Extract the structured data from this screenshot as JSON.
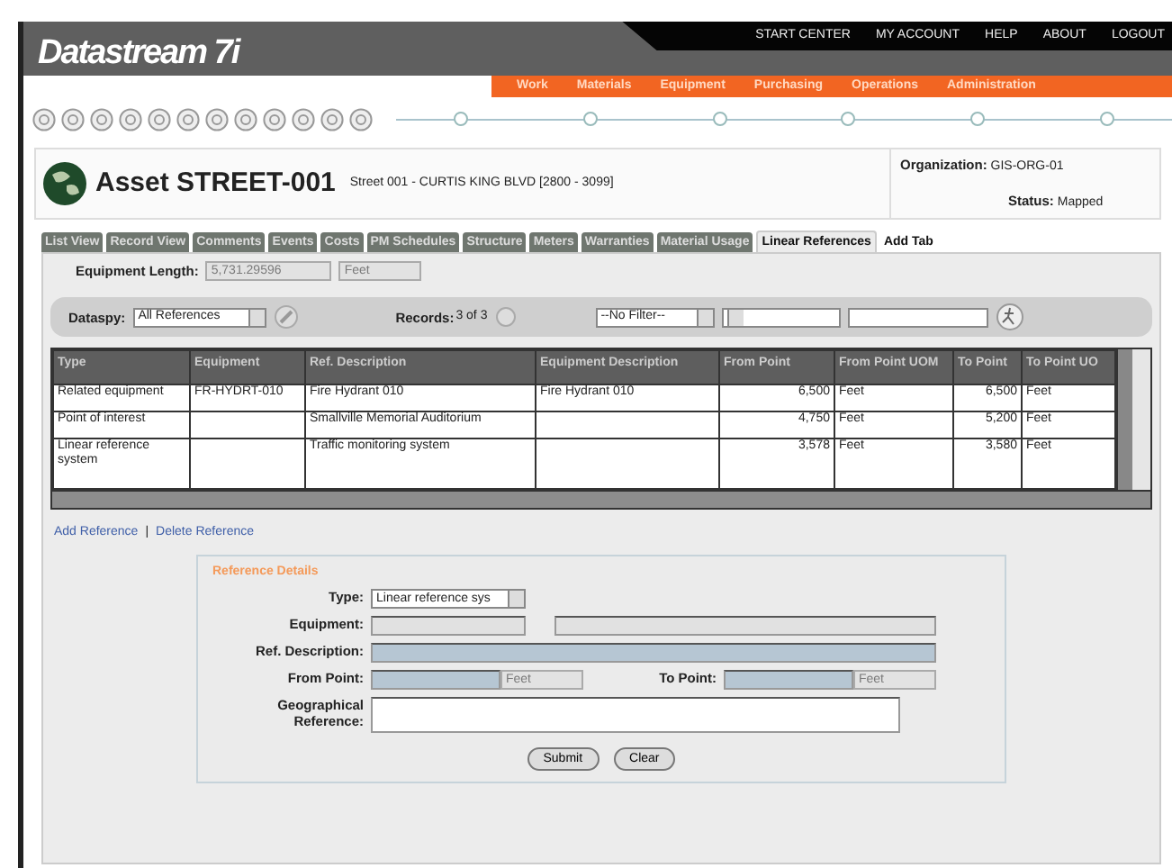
{
  "header": {
    "logo": "Datastream 7i",
    "top_links": [
      "START CENTER",
      "MY ACCOUNT",
      "HELP",
      "ABOUT",
      "LOGOUT"
    ],
    "modules": [
      "Work",
      "Materials",
      "Equipment",
      "Purchasing",
      "Operations",
      "Administration"
    ]
  },
  "asset": {
    "title": "Asset STREET-001",
    "subtitle": "Street 001 - CURTIS KING BLVD [2800 - 3099]",
    "organization_label": "Organization:",
    "organization": "GIS-ORG-01",
    "status_label": "Status:",
    "status": "Mapped"
  },
  "tabs": [
    {
      "label": "List View",
      "selected": false
    },
    {
      "label": "Record View",
      "selected": false
    },
    {
      "label": "Comments",
      "selected": false
    },
    {
      "label": "Events",
      "selected": false
    },
    {
      "label": "Costs",
      "selected": false
    },
    {
      "label": "PM Schedules",
      "selected": false
    },
    {
      "label": "Structure",
      "selected": false
    },
    {
      "label": "Meters",
      "selected": false
    },
    {
      "label": "Warranties",
      "selected": false
    },
    {
      "label": "Material Usage",
      "selected": false
    },
    {
      "label": "Linear References",
      "selected": true
    },
    {
      "label": "Add Tab",
      "selected": false
    }
  ],
  "equipment_length": {
    "label": "Equipment Length:",
    "value": "5,731.29596",
    "unit": "Feet"
  },
  "dataspy": {
    "label": "Dataspy:",
    "value": "All References",
    "records_label": "Records:",
    "records_value": "3 of 3",
    "filter": "--No Filter--"
  },
  "table": {
    "columns": [
      "Type",
      "Equipment",
      "Ref. Description",
      "Equipment Description",
      "From Point",
      "From Point UOM",
      "To Point",
      "To Point UO"
    ],
    "rows": [
      [
        "Related equipment",
        "FR-HYDRT-010",
        "Fire Hydrant 010",
        "Fire Hydrant 010",
        "6,500",
        "Feet",
        "6,500",
        "Feet"
      ],
      [
        "Point of interest",
        "",
        "Smallville Memorial Auditorium",
        "",
        "4,750",
        "Feet",
        "5,200",
        "Feet"
      ],
      [
        "Linear reference system",
        "",
        "Traffic monitoring system",
        "",
        "3,578",
        "Feet",
        "3,580",
        "Feet"
      ]
    ]
  },
  "links": [
    "Add Reference",
    "Delete Reference"
  ],
  "link_separator": "|",
  "reference_details": {
    "title": "Reference Details",
    "type_label": "Type:",
    "type_value": "Linear reference sys",
    "equipment_label": "Equipment:",
    "ref_description_label": "Ref. Description:",
    "from_point_label": "From Point:",
    "from_point_unit": "Feet",
    "to_point_label": "To Point:",
    "to_point_unit": "Feet",
    "geo_label": "Geographical Reference:"
  },
  "buttons": [
    "Submit",
    "Clear"
  ]
}
